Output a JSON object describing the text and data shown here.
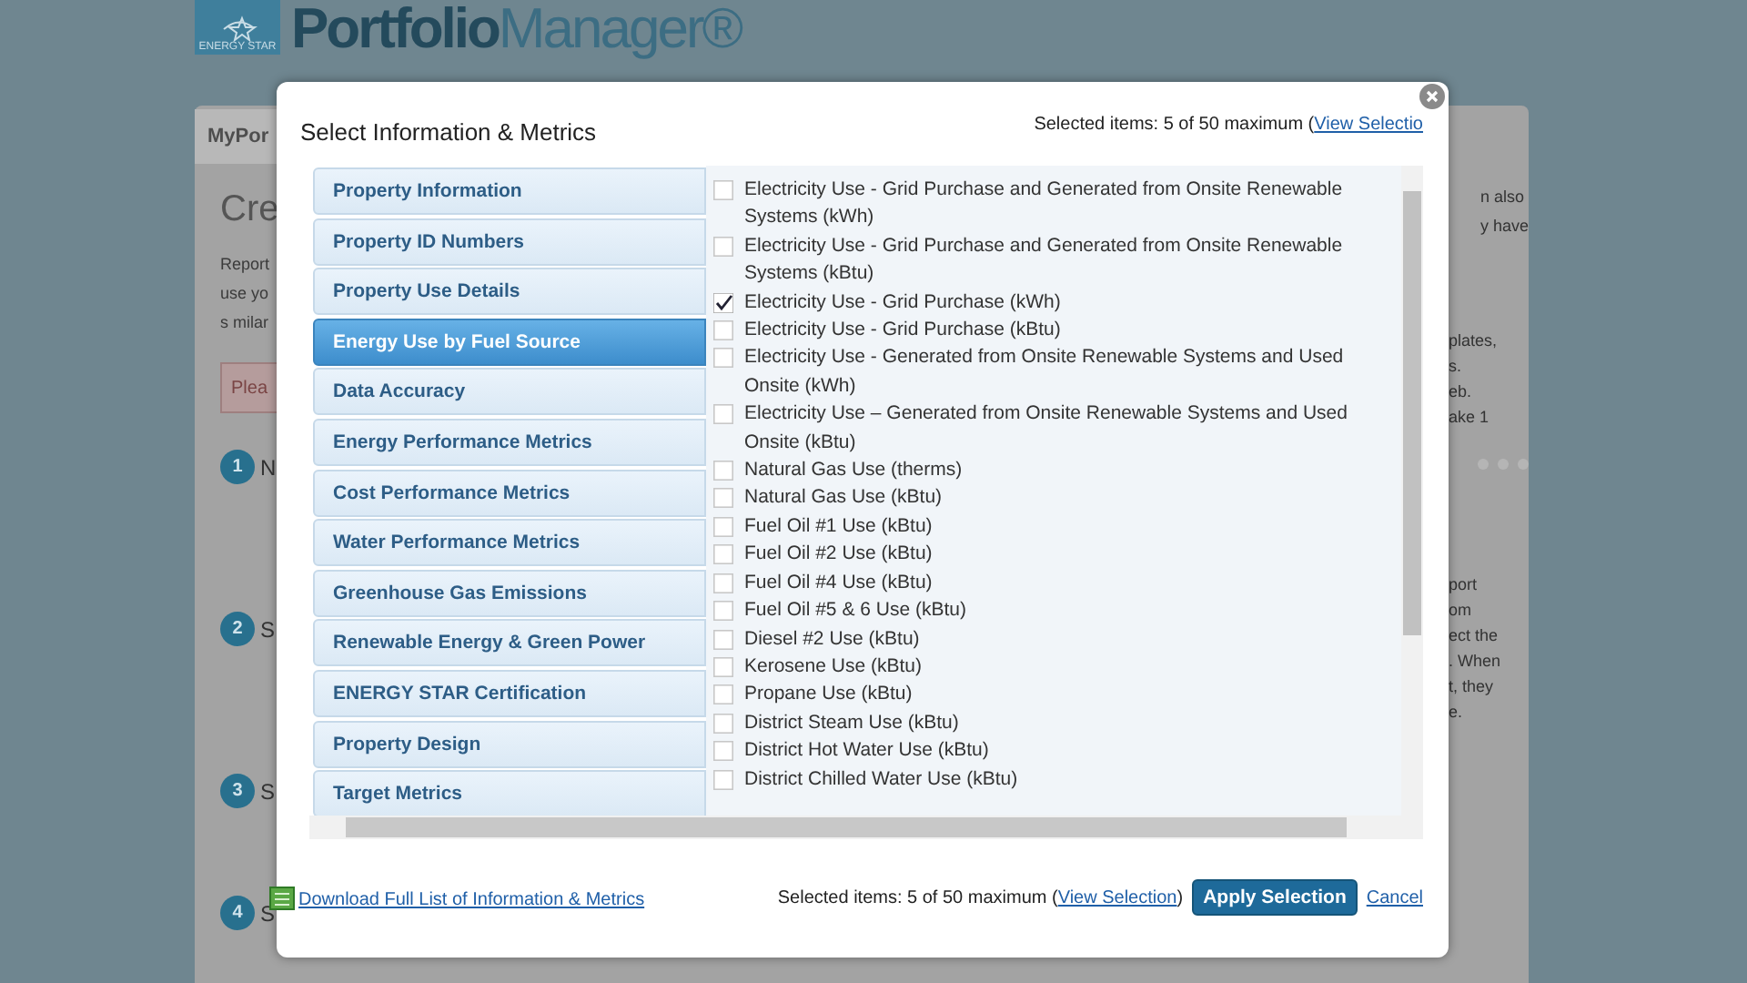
{
  "logo": {
    "badge": "ENERGY STAR",
    "name": "Portfolio",
    "name_light": "Manager®"
  },
  "page": {
    "tab": "MyPor",
    "heading": "Cre",
    "intro": [
      "Report",
      "use yo",
      "s milar"
    ],
    "intro_right": [
      "n also",
      "y have"
    ],
    "alert": "Plea",
    "steps": [
      {
        "number": "1",
        "label": "N",
        "notes": [
          "plates,",
          "s.",
          "eb.",
          "ake 1"
        ]
      },
      {
        "number": "2",
        "label": "S",
        "notes": [
          "port",
          "om",
          "ect the",
          ". When",
          "t, they",
          "e."
        ]
      },
      {
        "number": "3",
        "label": "S"
      },
      {
        "number": "4",
        "label": "S"
      }
    ]
  },
  "dialog": {
    "title": "Select Information & Metrics",
    "top_info": {
      "text": "Selected items: 5 of 50 maximum (",
      "link": "View Selectio"
    },
    "categories": [
      {
        "label": "Property Information",
        "selected": false
      },
      {
        "label": "Property ID Numbers",
        "selected": false
      },
      {
        "label": "Property Use Details",
        "selected": false
      },
      {
        "label": "Energy Use by Fuel Source",
        "selected": true
      },
      {
        "label": "Data Accuracy",
        "selected": false
      },
      {
        "label": "Energy Performance Metrics",
        "selected": false
      },
      {
        "label": "Cost Performance Metrics",
        "selected": false
      },
      {
        "label": "Water Performance Metrics",
        "selected": false
      },
      {
        "label": "Greenhouse Gas Emissions",
        "selected": false
      },
      {
        "label": "Renewable Energy & Green Power",
        "selected": false
      },
      {
        "label": "ENERGY STAR Certification",
        "selected": false
      },
      {
        "label": "Property Design",
        "selected": false
      },
      {
        "label": "Target Metrics",
        "selected": false
      }
    ],
    "metrics": [
      {
        "label": "Electricity Use - Grid Purchase and Generated from Onsite Renewable Systems (kWh)",
        "checked": false
      },
      {
        "label": "Electricity Use - Grid Purchase and Generated from Onsite Renewable Systems (kBtu)",
        "checked": false
      },
      {
        "label": "Electricity Use - Grid Purchase (kWh)",
        "checked": true
      },
      {
        "label": "Electricity Use - Grid Purchase (kBtu)",
        "checked": false
      },
      {
        "label": "Electricity Use - Generated from Onsite Renewable Systems and Used Onsite (kWh)",
        "checked": false
      },
      {
        "label": "Electricity Use – Generated from Onsite Renewable Systems and Used Onsite (kBtu)",
        "checked": false
      },
      {
        "label": "Natural Gas Use (therms)",
        "checked": false
      },
      {
        "label": "Natural Gas Use (kBtu)",
        "checked": false
      },
      {
        "label": "Fuel Oil #1 Use (kBtu)",
        "checked": false
      },
      {
        "label": "Fuel Oil #2 Use (kBtu)",
        "checked": false
      },
      {
        "label": "Fuel Oil #4 Use (kBtu)",
        "checked": false
      },
      {
        "label": "Fuel Oil #5 & 6 Use (kBtu)",
        "checked": false
      },
      {
        "label": "Diesel #2 Use (kBtu)",
        "checked": false
      },
      {
        "label": "Kerosene Use (kBtu)",
        "checked": false
      },
      {
        "label": "Propane Use (kBtu)",
        "checked": false
      },
      {
        "label": "District Steam Use (kBtu)",
        "checked": false
      },
      {
        "label": "District Hot Water Use (kBtu)",
        "checked": false
      },
      {
        "label": "District Chilled Water Use (kBtu)",
        "checked": false
      }
    ],
    "download_link": "Download Full List of Information & Metrics",
    "bottom_info": {
      "text": "Selected items: 5 of 50 maximum (",
      "link": "View Selection",
      "close": ")"
    },
    "apply_button": "Apply Selection",
    "cancel_link": "Cancel"
  }
}
